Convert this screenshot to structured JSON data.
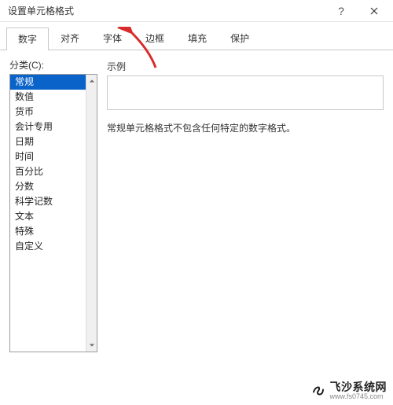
{
  "window": {
    "title": "设置单元格格式"
  },
  "tabs": [
    {
      "label": "数字",
      "active": true
    },
    {
      "label": "对齐",
      "active": false
    },
    {
      "label": "字体",
      "active": false
    },
    {
      "label": "边框",
      "active": false
    },
    {
      "label": "填充",
      "active": false
    },
    {
      "label": "保护",
      "active": false
    }
  ],
  "category_label": "分类(C):",
  "categories": [
    {
      "label": "常规",
      "selected": true
    },
    {
      "label": "数值",
      "selected": false
    },
    {
      "label": "货币",
      "selected": false
    },
    {
      "label": "会计专用",
      "selected": false
    },
    {
      "label": "日期",
      "selected": false
    },
    {
      "label": "时间",
      "selected": false
    },
    {
      "label": "百分比",
      "selected": false
    },
    {
      "label": "分数",
      "selected": false
    },
    {
      "label": "科学记数",
      "selected": false
    },
    {
      "label": "文本",
      "selected": false
    },
    {
      "label": "特殊",
      "selected": false
    },
    {
      "label": "自定义",
      "selected": false
    }
  ],
  "sample_label": "示例",
  "description": "常规单元格格式不包含任何特定的数字格式。",
  "watermark": {
    "main": "飞沙系统网",
    "sub": "www.fs0745.com"
  }
}
